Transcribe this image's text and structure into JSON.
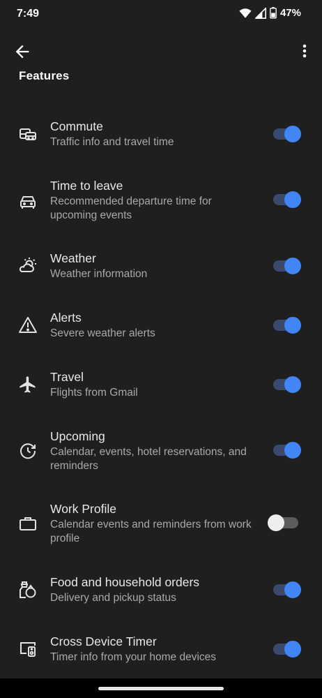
{
  "status_bar": {
    "time": "7:49",
    "battery_pct": "47%",
    "icons": [
      "wifi-icon",
      "cell-signal-icon",
      "battery-icon"
    ]
  },
  "app_bar": {
    "back_icon": "arrow-back-icon",
    "more_icon": "more-vert-icon"
  },
  "section_title": "Features",
  "colors": {
    "background": "#1f1f1f",
    "toggle_on_thumb": "#4285f4",
    "toggle_on_track": "#394a6d",
    "toggle_off_thumb": "#eeeeee",
    "toggle_off_track": "#5c5c5c"
  },
  "items": [
    {
      "title": "Commute",
      "subtitle": "Traffic info and travel time",
      "enabled": true,
      "icon": "commute-icon"
    },
    {
      "title": "Time to leave",
      "subtitle": "Recommended departure time for upcoming events",
      "enabled": true,
      "icon": "car-icon"
    },
    {
      "title": "Weather",
      "subtitle": "Weather information",
      "enabled": true,
      "icon": "weather-icon"
    },
    {
      "title": "Alerts",
      "subtitle": "Severe weather alerts",
      "enabled": true,
      "icon": "warning-icon"
    },
    {
      "title": "Travel",
      "subtitle": "Flights from Gmail",
      "enabled": true,
      "icon": "flight-icon"
    },
    {
      "title": "Upcoming",
      "subtitle": "Calendar, events, hotel reservations, and reminders",
      "enabled": true,
      "icon": "upcoming-icon"
    },
    {
      "title": "Work Profile",
      "subtitle": "Calendar events and reminders from work profile",
      "enabled": false,
      "icon": "briefcase-icon"
    },
    {
      "title": "Food and household orders",
      "subtitle": "Delivery and pickup status",
      "enabled": true,
      "icon": "orders-icon"
    },
    {
      "title": "Cross Device Timer",
      "subtitle": "Timer info from your home devices",
      "enabled": true,
      "icon": "device-timer-icon"
    }
  ]
}
